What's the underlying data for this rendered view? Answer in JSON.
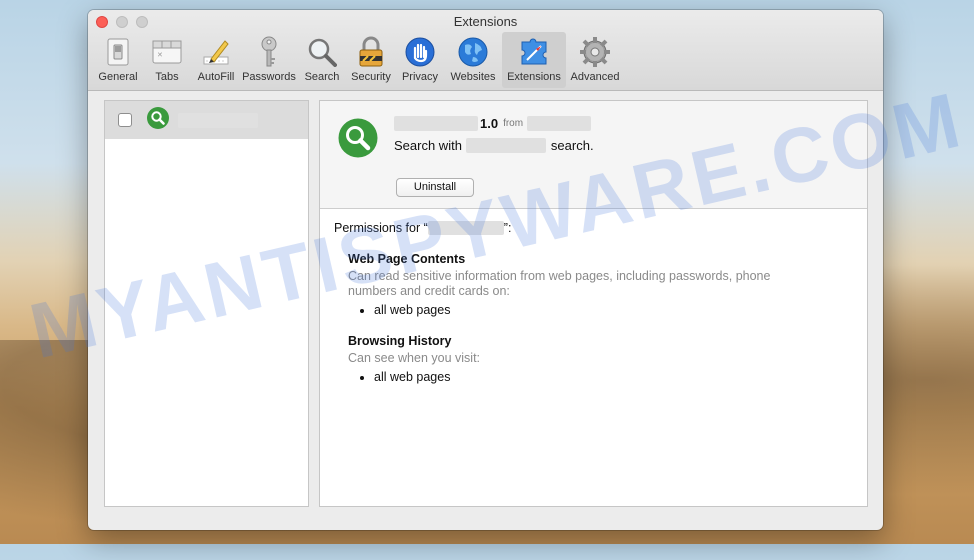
{
  "window": {
    "title": "Extensions"
  },
  "toolbar": {
    "items": [
      {
        "label": "General",
        "icon": "switch-icon"
      },
      {
        "label": "Tabs",
        "icon": "tabs-icon"
      },
      {
        "label": "AutoFill",
        "icon": "pencil-icon"
      },
      {
        "label": "Passwords",
        "icon": "key-icon"
      },
      {
        "label": "Search",
        "icon": "magnifier-icon"
      },
      {
        "label": "Security",
        "icon": "padlock-icon"
      },
      {
        "label": "Privacy",
        "icon": "hand-icon"
      },
      {
        "label": "Websites",
        "icon": "globe-icon"
      },
      {
        "label": "Extensions",
        "icon": "puzzle-compass-icon"
      },
      {
        "label": "Advanced",
        "icon": "gear-icon"
      }
    ],
    "selected": "Extensions"
  },
  "sidebar": {
    "extension_enabled": false
  },
  "detail": {
    "version": "1.0",
    "from_label": "from",
    "desc_prefix": "Search with",
    "desc_suffix": "search.",
    "uninstall_label": "Uninstall",
    "permissions_prefix": "Permissions for “",
    "permissions_suffix": "”:",
    "sections": [
      {
        "title": "Web Page Contents",
        "desc": "Can read sensitive information from web pages, including passwords, phone numbers and credit cards on:",
        "items": [
          "all web pages"
        ]
      },
      {
        "title": "Browsing History",
        "desc": "Can see when you visit:",
        "items": [
          "all web pages"
        ]
      }
    ]
  },
  "watermark": "MYANTISPYWARE.COM",
  "colors": {
    "extension_green": "#3a9a3d",
    "close_red": "#fc5f57"
  }
}
